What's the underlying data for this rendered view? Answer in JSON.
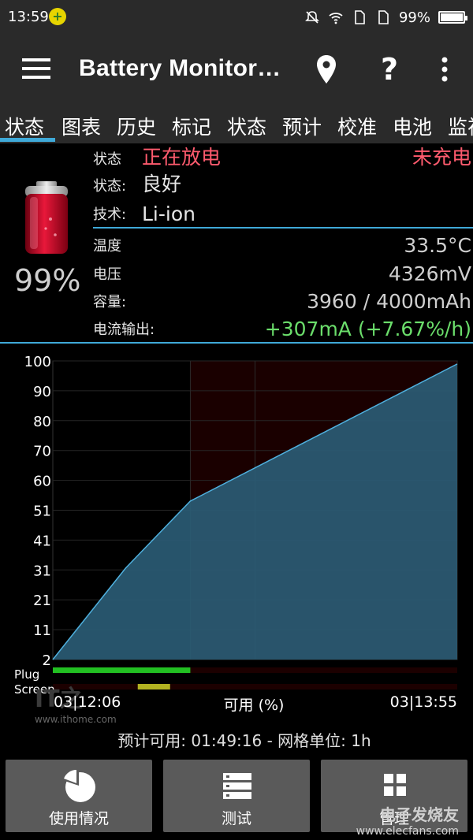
{
  "status_bar": {
    "time": "13:59",
    "notif_glyph": "+",
    "battery_pct_text": "99%",
    "battery_level": 0.99,
    "icons": [
      "mute-icon",
      "wifi-icon",
      "sim-icon",
      "sim-icon"
    ]
  },
  "app_bar": {
    "title": "Battery Monitor…",
    "help_glyph": "?"
  },
  "tabs": [
    "状态",
    "图表",
    "历史",
    "标记",
    "状态",
    "预计",
    "校准",
    "电池",
    "监视"
  ],
  "active_tab": 0,
  "status": {
    "row1_label": "状态",
    "row1_value": "正在放电",
    "row1_right": "未充电",
    "row2_label": "状态:",
    "row2_value": "良好",
    "row3_label": "技术:",
    "row3_value": "Li-ion",
    "temp_label": "温度",
    "temp_value": "33.5°C",
    "volt_label": "电压",
    "volt_value": "4326mV",
    "cap_label": "容量:",
    "cap_value": "3960 / 4000mAh",
    "current_label": "电流输出:",
    "current_value": "+307mA (+7.67%/h)",
    "battery_percent": "99%",
    "battery_level": 0.99
  },
  "chart_data": {
    "type": "area",
    "y_ticks": [
      "100",
      "90",
      "80",
      "70",
      "60",
      "51",
      "41",
      "31",
      "21",
      "11",
      "2"
    ],
    "ylim": [
      2,
      100
    ],
    "x_points": [
      0,
      0.18,
      0.34,
      1.0
    ],
    "y_points": [
      2,
      32,
      54,
      99
    ],
    "highlight_start": 0.34,
    "xlabel_left": "03|12:06",
    "xlabel_center": "可用 (%)",
    "xlabel_right": "03|13:55",
    "plug_label": "Plug",
    "screen_label": "Screen",
    "plug_on": [
      0,
      0.34
    ],
    "screen_on": [
      0.21,
      0.29
    ],
    "colors": {
      "fill": "#2b5d77",
      "line": "#4fb0de",
      "plug": "#22c022",
      "screen": "#b3b321",
      "highlight": "#1a0000"
    }
  },
  "estimate_text": "预计可用: 01:49:16 - 网格单位:  1h",
  "watermark": {
    "logo": "IT之",
    "url": "www.ithome.com",
    "elec": "电子发烧友",
    "elec_url": "www.elecfans.com"
  },
  "buttons": [
    {
      "label": "使用情况",
      "icon": "pie-chart-icon"
    },
    {
      "label": "测试",
      "icon": "server-list-icon"
    },
    {
      "label": "管理",
      "icon": "grid-icon"
    }
  ]
}
